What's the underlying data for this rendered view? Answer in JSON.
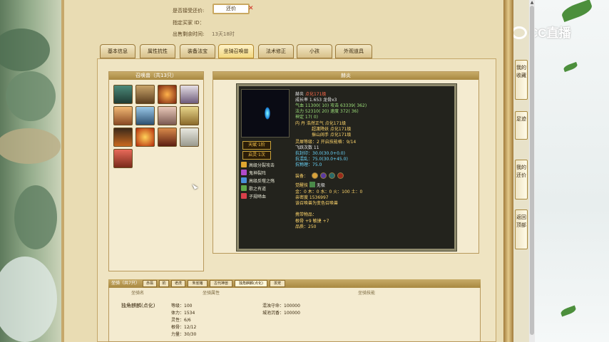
{
  "header": {
    "accept_label": "是否接受还价:",
    "price_button": "还价",
    "buyer_label": "指定买家 ID：",
    "time_label": "出售剩余时间:",
    "time_value": "13天18时"
  },
  "tabs": [
    "基本信息",
    "属性抗性",
    "装备法宝",
    "坐骑召唤兽",
    "法术修正",
    "小孩",
    "外观道具"
  ],
  "beasts": {
    "title": "召唤兽（共13只）",
    "count": 13
  },
  "detail": {
    "title": "赫炎",
    "name": "赫炎",
    "name_tag": "点化171级",
    "growth": "成长率 1.653 龙骨x3",
    "hp": "气血 11300(  10) 攻击 63339( 362)",
    "mp": "法力 52310( 20) 速度 372( 36)",
    "god": "神定 17( 0)",
    "inner": "内   丹  浩然正气 点化171级",
    "inner2": "超渡降妖 点化171级",
    "inner3": "振山阔手 点化171级",
    "spirit": "灵犀等级：2  开启技能格：9/14",
    "reborn": "飞跃次数 11",
    "seal": "抗封印：30.0(30.0+0.0)",
    "mind": "抗混乱：75.0(30.0+45.0)",
    "phys": "抗物理：75.0",
    "gear_label": "装备：",
    "awaken_label": "觉醒技",
    "awaken_value": "无极",
    "elements": "金：0 木：0 水：0 火：100 土：0",
    "exp": "亲密度 1536997",
    "note": "该召唤兽为变色召唤兽",
    "items_label": "携带物品：",
    "item1": "根骨 +9 敏捷 +7",
    "item2": "品质：250",
    "innate": "天赋·1阶",
    "star": "启灵·1次"
  },
  "skills": [
    "高级分裂攻击",
    "鬼神裂阵",
    "高级反噬之殇",
    "歌之有道",
    "子规啼血"
  ],
  "mounts": {
    "title": "坐骑（共7只）",
    "tabs": [
      "赤翡",
      "豹",
      "老虎",
      "朱雀猪",
      "古代神兽",
      "独角麒麟(点化)",
      "羡宠"
    ],
    "active_tab": 5,
    "col_name": "坐骑名",
    "col_attr": "坐骑属性",
    "col_skill": "坐骑技能",
    "name": "独角麒麟(点化)",
    "attrs": [
      "等级：100",
      "体力：1534",
      "灵性：6/6",
      "根骨：12/12",
      "力量：30/30"
    ],
    "skills": [
      "混浊守命：100000",
      "城池沉香：100000"
    ]
  },
  "side_tabs": [
    "我的收藏",
    "足迹",
    "我的还价",
    "返回顶部"
  ],
  "logo_text": "CC直播",
  "colors": {
    "accent": "#c9a861",
    "panel": "#efe4c2",
    "card": "#23231d"
  }
}
